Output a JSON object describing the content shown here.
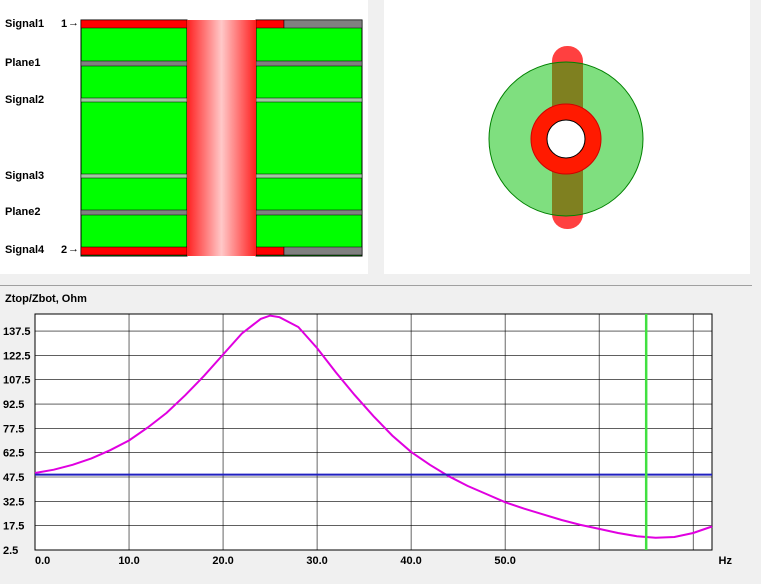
{
  "stackup": {
    "layers": [
      {
        "label": "Signal1",
        "port": "1"
      },
      {
        "label": "Plane1",
        "port": ""
      },
      {
        "label": "Signal2",
        "port": ""
      },
      {
        "label": "Signal3",
        "port": ""
      },
      {
        "label": "Plane2",
        "port": ""
      },
      {
        "label": "Signal4",
        "port": "2"
      }
    ],
    "port_arrow": "→",
    "colors": {
      "dielectric": "#00ff00",
      "signal_trace": "#ff0000",
      "plane": "#808080",
      "via_barrel": "#ff3030"
    }
  },
  "via_top_view": {
    "colors": {
      "antipad": "#80e880",
      "pad": "#ff1a00",
      "trace": "#ff2020",
      "drill": "#ffffff"
    }
  },
  "chart_data": {
    "type": "line",
    "title": "Ztop/Zbot, Ohm",
    "xlabel": "",
    "ylabel": "Ztop/Zbot, Ohm",
    "xlim": [
      0,
      72
    ],
    "ylim": [
      2.5,
      148
    ],
    "x_ticks": [
      "0.0",
      "10.0",
      "20.0",
      "30.0",
      "40.0",
      "50.0"
    ],
    "y_ticks": [
      "2.5",
      "17.5",
      "32.5",
      "47.5",
      "62.5",
      "77.5",
      "92.5",
      "107.5",
      "122.5",
      "137.5"
    ],
    "x_unit_label": "Hz",
    "marker_x": 65,
    "grid": true,
    "series": [
      {
        "color": "#e000e0",
        "x": [
          0,
          2,
          4,
          6,
          8,
          10,
          12,
          14,
          16,
          18,
          20,
          22,
          24,
          25,
          26,
          28,
          30,
          32,
          34,
          36,
          38,
          40,
          42,
          44,
          46,
          48,
          50,
          52,
          54,
          56,
          58,
          60,
          62,
          64,
          66,
          68,
          70,
          72
        ],
        "y": [
          50,
          52,
          55,
          59,
          64,
          70,
          78,
          87,
          98,
          110,
          123,
          136,
          145,
          147,
          146,
          140,
          127,
          112,
          98,
          85,
          73,
          63,
          55,
          48,
          42,
          37,
          32,
          28,
          24.5,
          21,
          18,
          15.5,
          13,
          11,
          10,
          10.5,
          13,
          17
        ]
      },
      {
        "color": "#2020c0",
        "x": [
          0,
          72
        ],
        "y": [
          49,
          49
        ]
      }
    ],
    "marker_color": "#40e040"
  }
}
